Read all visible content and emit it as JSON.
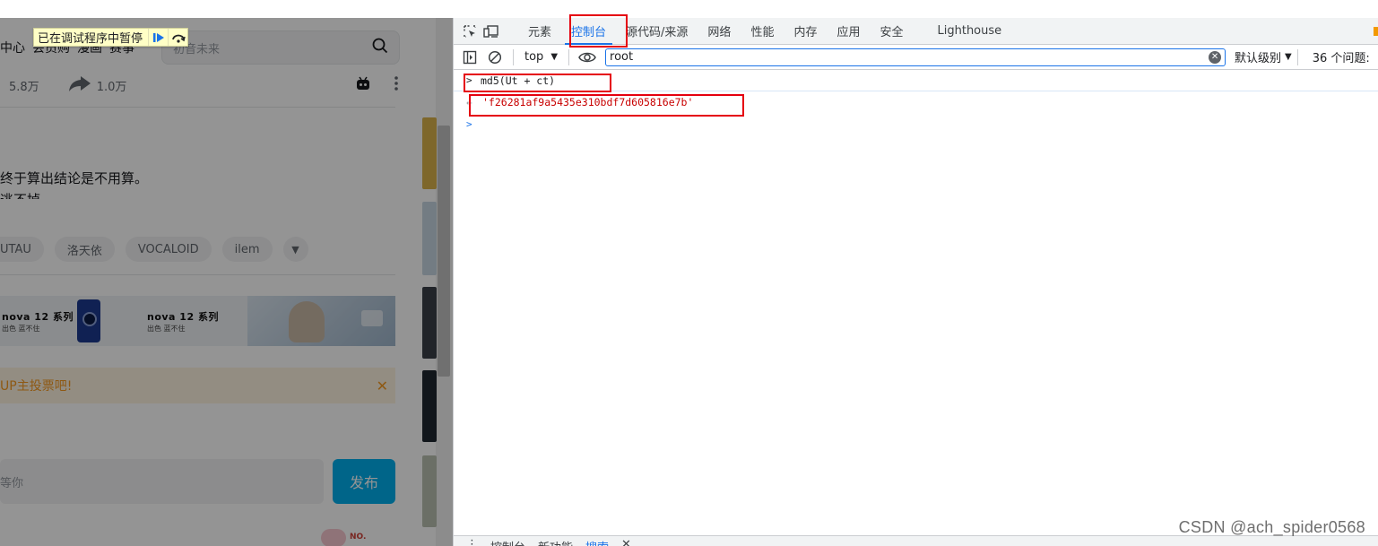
{
  "paused_badge": {
    "text": "已在调试程序中暂停",
    "resume_icon": "resume-icon",
    "step_over_icon": "step-over-icon"
  },
  "page": {
    "nav_items": [
      "中心",
      "会员购",
      "漫画",
      "赛事"
    ],
    "search_placeholder": "初音未来",
    "stats": [
      {
        "icon": "coin-icon",
        "value": "5.8万"
      },
      {
        "icon": "share-icon",
        "value": "1.0万"
      }
    ],
    "description_line1": "终于算出结论是不用算。",
    "description_line2": "逃不掉",
    "tags": [
      "UTAU",
      "洛天依",
      "VOCALOID",
      "ilem"
    ],
    "ad": {
      "brand1": "nova 12 系列",
      "sub1": "出色 蓝不住",
      "brand2": "nova 12 系列",
      "sub2": "出色 蓝不住"
    },
    "banner_text": "UP主投票吧!",
    "comment_placeholder": "等你",
    "post_button": "发布",
    "mascot_text": "NO."
  },
  "devtools": {
    "tabs": [
      "元素",
      "控制台",
      "源代码/来源",
      "网络",
      "性能",
      "内存",
      "应用",
      "安全",
      "Lighthouse"
    ],
    "active_tab": "控制台",
    "context": "top",
    "filter_value": "root",
    "log_level": "默认级别",
    "issues": "36 个问题:",
    "console": {
      "input": "md5(Ut + ct)",
      "result": "'f26281af9a5435e310bdf7d605816e7b'"
    },
    "drawer_tabs": [
      "控制台",
      "新功能",
      "搜索"
    ]
  },
  "watermark": "CSDN @ach_spider0568",
  "colors": {
    "accent": "#1a73e8",
    "highlight_box": "#e5000f",
    "string_value": "#c80000",
    "post_button": "#00aeec",
    "paused_badge_bg": "#ffffc6"
  }
}
